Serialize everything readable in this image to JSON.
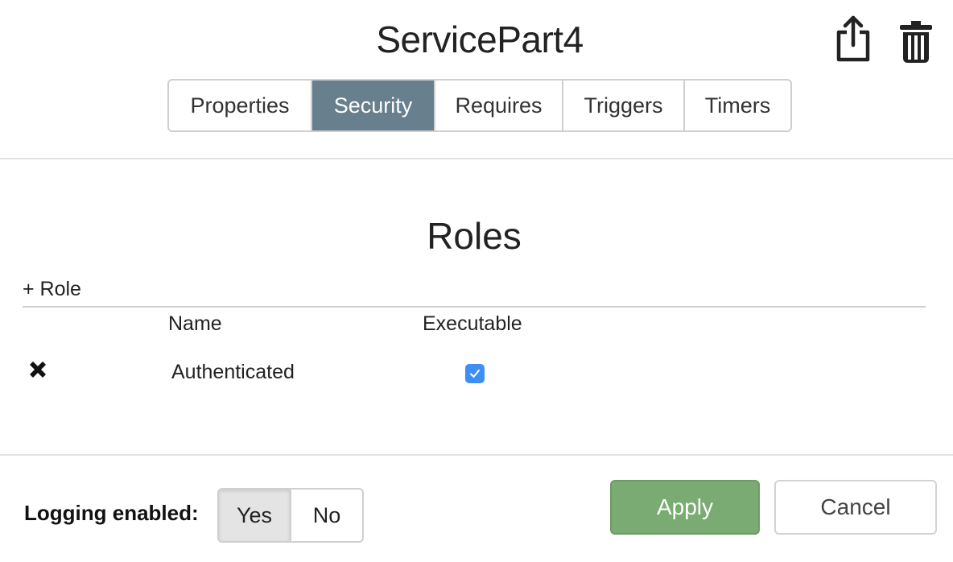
{
  "header": {
    "title": "ServicePart4",
    "icons": [
      "share-icon",
      "trash-icon"
    ]
  },
  "tabs": [
    {
      "label": "Properties",
      "active": false
    },
    {
      "label": "Security",
      "active": true
    },
    {
      "label": "Requires",
      "active": false
    },
    {
      "label": "Triggers",
      "active": false
    },
    {
      "label": "Timers",
      "active": false
    }
  ],
  "roles": {
    "heading": "Roles",
    "add_label": "+ Role",
    "columns": {
      "name": "Name",
      "executable": "Executable"
    },
    "rows": [
      {
        "name": "Authenticated",
        "executable": true
      }
    ]
  },
  "footer": {
    "logging_label": "Logging enabled:",
    "logging_options": [
      "Yes",
      "No"
    ],
    "logging_selected": "Yes",
    "apply_label": "Apply",
    "cancel_label": "Cancel"
  },
  "colors": {
    "active_tab": "#687f8d",
    "apply_button": "#7aab72",
    "checkbox": "#3d8ef5"
  }
}
